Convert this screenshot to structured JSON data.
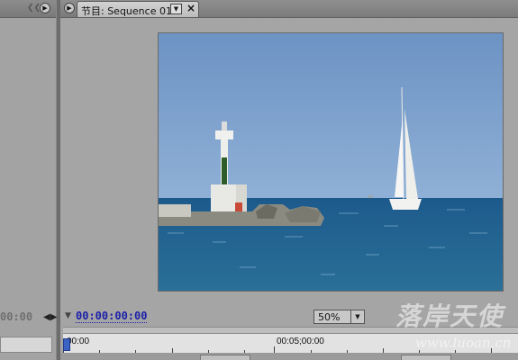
{
  "program_monitor": {
    "tab_title": "节目: Sequence 01",
    "timecode": "00:00:00:00",
    "zoom": {
      "selected": "50%"
    },
    "ruler": {
      "start_label": "00:00",
      "mid_label": "00:05;00:00"
    }
  },
  "source_monitor": {
    "timecode": "00:00"
  },
  "watermark": {
    "title": "落岸天使",
    "url": "www.luoan.cn"
  },
  "colors": {
    "timecode_blue": "#1a1fa8",
    "panel_gray": "#a5a5a5",
    "playhead_blue": "#3b63c4"
  }
}
